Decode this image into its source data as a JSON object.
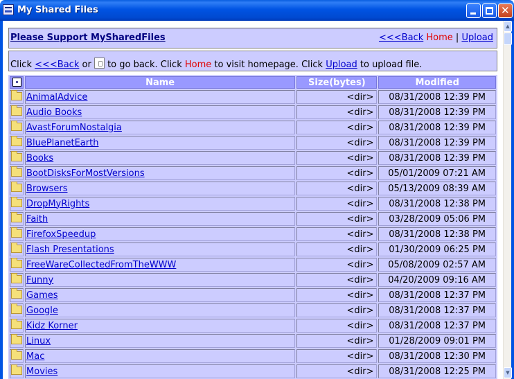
{
  "window": {
    "title": "My Shared Files"
  },
  "header": {
    "support_link": "Please Support MySharedFiles",
    "back_link": "<<<Back",
    "home_label": "Home",
    "separator": "|",
    "upload_link": "Upload"
  },
  "info": {
    "part1": "Click ",
    "back_link": "<<<Back",
    "part2": " or ",
    "part3": " to go back. Click ",
    "home_label": "Home",
    "part4": " to visit homepage. Click ",
    "upload_link": "Upload",
    "part5": " to upload file."
  },
  "table": {
    "columns": {
      "name": "Name",
      "size": "Size(bytes)",
      "modified": "Modified"
    },
    "rows": [
      {
        "name": "AnimalAdvice",
        "size": "<dir>",
        "modified": "08/31/2008 12:39 PM"
      },
      {
        "name": "Audio Books",
        "size": "<dir>",
        "modified": "08/31/2008 12:39 PM"
      },
      {
        "name": "AvastForumNostalgia",
        "size": "<dir>",
        "modified": "08/31/2008 12:39 PM"
      },
      {
        "name": "BluePlanetEarth",
        "size": "<dir>",
        "modified": "08/31/2008 12:39 PM"
      },
      {
        "name": "Books",
        "size": "<dir>",
        "modified": "08/31/2008 12:39 PM"
      },
      {
        "name": "BootDisksForMostVersions",
        "size": "<dir>",
        "modified": "05/01/2009 07:21 AM"
      },
      {
        "name": "Browsers",
        "size": "<dir>",
        "modified": "05/13/2009 08:39 AM"
      },
      {
        "name": "DropMyRights",
        "size": "<dir>",
        "modified": "08/31/2008 12:38 PM"
      },
      {
        "name": "Faith",
        "size": "<dir>",
        "modified": "03/28/2009 05:06 PM"
      },
      {
        "name": "FirefoxSpeedup",
        "size": "<dir>",
        "modified": "08/31/2008 12:38 PM"
      },
      {
        "name": "Flash Presentations",
        "size": "<dir>",
        "modified": "01/30/2009 06:25 PM"
      },
      {
        "name": "FreeWareCollectedFromTheWWW",
        "size": "<dir>",
        "modified": "05/08/2009 02:57 AM"
      },
      {
        "name": "Funny",
        "size": "<dir>",
        "modified": "04/20/2009 09:16 AM"
      },
      {
        "name": "Games",
        "size": "<dir>",
        "modified": "08/31/2008 12:37 PM"
      },
      {
        "name": "Google",
        "size": "<dir>",
        "modified": "08/31/2008 12:37 PM"
      },
      {
        "name": "Kidz Korner",
        "size": "<dir>",
        "modified": "08/31/2008 12:37 PM"
      },
      {
        "name": "Linux",
        "size": "<dir>",
        "modified": "01/28/2009 09:01 PM"
      },
      {
        "name": "Mac",
        "size": "<dir>",
        "modified": "08/31/2008 12:30 PM"
      },
      {
        "name": "Movies",
        "size": "<dir>",
        "modified": "08/31/2008 12:25 PM"
      }
    ]
  },
  "colors": {
    "panel": "#ccccff",
    "header": "#9999ff",
    "link": "#0000cc",
    "home": "#e00000",
    "titlebar": "#0054e3"
  }
}
